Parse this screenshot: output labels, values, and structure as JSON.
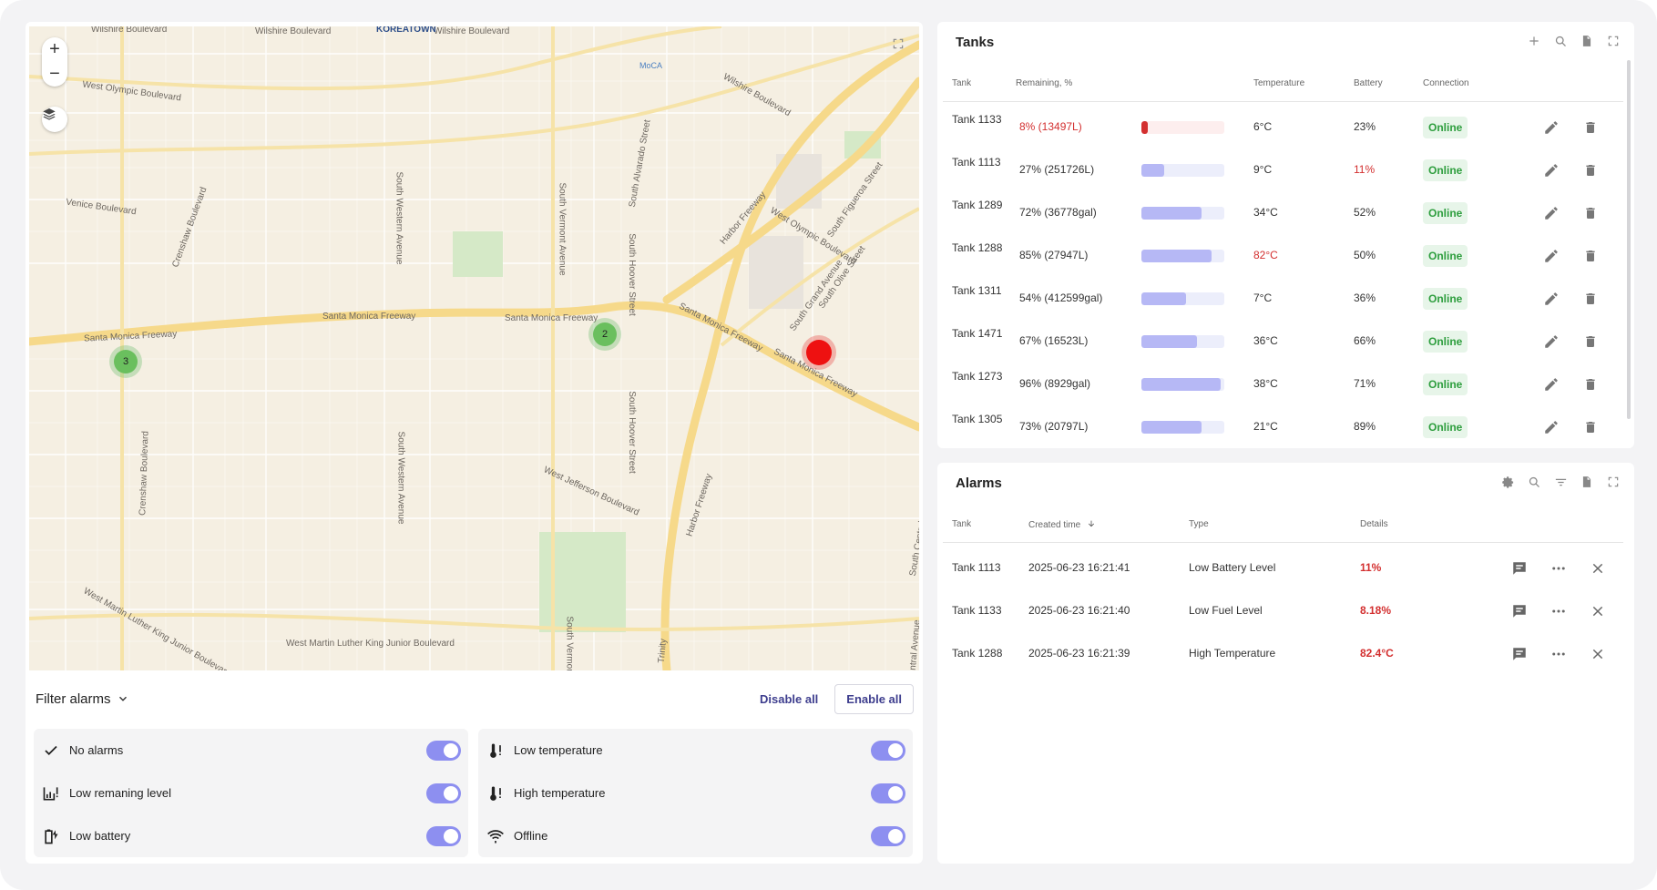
{
  "map": {
    "zoom_in": "+",
    "zoom_out": "−",
    "labels": [
      "Wilshire Boulevard",
      "Wilshire Boulevard",
      "Wilshire Boulevard",
      "KOREATOWN",
      "West Olympic Boulevard",
      "MoCA",
      "Venice Boulevard",
      "Crenshaw Boulevard",
      "South Western Avenue",
      "South Vermont Avenue",
      "South Hoover Street",
      "South Alvarado Street",
      "Wilshire Boulevard",
      "Santa Monica Freeway",
      "Santa Monica Freeway",
      "Santa Monica Freeway",
      "Santa Monica Freeway",
      "Santa Monica Freeway",
      "Harbor Freeway",
      "West Olympic Boulevard",
      "South Figueroa Street",
      "South Grand Avenue",
      "South Olive Street",
      "West Jefferson Boulevard",
      "Harbor Freeway",
      "Crenshaw Boulevard",
      "South Western Avenue",
      "West Martin Luther King Junior Boulevard",
      "West Martin Luther King Junior Boulevard",
      "South Vermont",
      "Trinity",
      "Central Avenue",
      "South Central Avenue",
      "South Hoover Street"
    ],
    "clusters": [
      "3",
      "2"
    ]
  },
  "filter": {
    "title": "Filter alarms",
    "disable_all": "Disable all",
    "enable_all": "Enable all",
    "left": [
      {
        "label": "No alarms",
        "icon": "check-icon",
        "enabled": true
      },
      {
        "label": "Low remaning level",
        "icon": "tank-level-alert-icon",
        "enabled": true
      },
      {
        "label": "Low battery",
        "icon": "battery-charging-icon",
        "enabled": true
      }
    ],
    "right": [
      {
        "label": "Low temperature",
        "icon": "thermometer-alert-icon",
        "enabled": true
      },
      {
        "label": "High temperature",
        "icon": "thermometer-high-alert-icon",
        "enabled": true
      },
      {
        "label": "Offline",
        "icon": "wifi-off-icon",
        "enabled": true
      }
    ]
  },
  "tanks": {
    "title": "Tanks",
    "columns": {
      "tank": "Tank",
      "remaining": "Remaining, %",
      "temperature": "Temperature",
      "battery": "Battery",
      "connection": "Connection"
    },
    "rows": [
      {
        "name": "Tank 1133",
        "remaining": "8% (13497L)",
        "level": 0.08,
        "temperature": "6°C",
        "battery": "23%",
        "connection": "Online",
        "low_level": true,
        "high_temp": false,
        "low_battery": false
      },
      {
        "name": "Tank 1113",
        "remaining": "27% (251726L)",
        "level": 0.27,
        "temperature": "9°C",
        "battery": "11%",
        "connection": "Online",
        "low_level": false,
        "high_temp": false,
        "low_battery": true
      },
      {
        "name": "Tank 1289",
        "remaining": "72% (36778gal)",
        "level": 0.72,
        "temperature": "34°C",
        "battery": "52%",
        "connection": "Online",
        "low_level": false,
        "high_temp": false,
        "low_battery": false
      },
      {
        "name": "Tank 1288",
        "remaining": "85% (27947L)",
        "level": 0.85,
        "temperature": "82°C",
        "battery": "50%",
        "connection": "Online",
        "low_level": false,
        "high_temp": true,
        "low_battery": false
      },
      {
        "name": "Tank 1311",
        "remaining": "54% (412599gal)",
        "level": 0.54,
        "temperature": "7°C",
        "battery": "36%",
        "connection": "Online",
        "low_level": false,
        "high_temp": false,
        "low_battery": false
      },
      {
        "name": "Tank 1471",
        "remaining": "67% (16523L)",
        "level": 0.67,
        "temperature": "36°C",
        "battery": "66%",
        "connection": "Online",
        "low_level": false,
        "high_temp": false,
        "low_battery": false
      },
      {
        "name": "Tank 1273",
        "remaining": "96% (8929gal)",
        "level": 0.96,
        "temperature": "38°C",
        "battery": "71%",
        "connection": "Online",
        "low_level": false,
        "high_temp": false,
        "low_battery": false
      },
      {
        "name": "Tank 1305",
        "remaining": "73% (20797L)",
        "level": 0.73,
        "temperature": "21°C",
        "battery": "89%",
        "connection": "Online",
        "low_level": false,
        "high_temp": false,
        "low_battery": false
      }
    ]
  },
  "alarms": {
    "title": "Alarms",
    "columns": {
      "tank": "Tank",
      "created": "Created time",
      "type": "Type",
      "details": "Details"
    },
    "rows": [
      {
        "tank": "Tank 1113",
        "created": "2025-06-23 16:21:41",
        "type": "Low Battery Level",
        "details": "11%"
      },
      {
        "tank": "Tank 1133",
        "created": "2025-06-23 16:21:40",
        "type": "Low Fuel Level",
        "details": "8.18%"
      },
      {
        "tank": "Tank 1288",
        "created": "2025-06-23 16:21:39",
        "type": "High Temperature",
        "details": "82.4°C"
      }
    ]
  },
  "colors": {
    "accent": "#3e3e8e",
    "toggle": "#8d8ff0",
    "alarm": "#d32f2f",
    "online": "#2e9e3e",
    "cluster": "#6abf5e",
    "pin": "#ee1111"
  }
}
